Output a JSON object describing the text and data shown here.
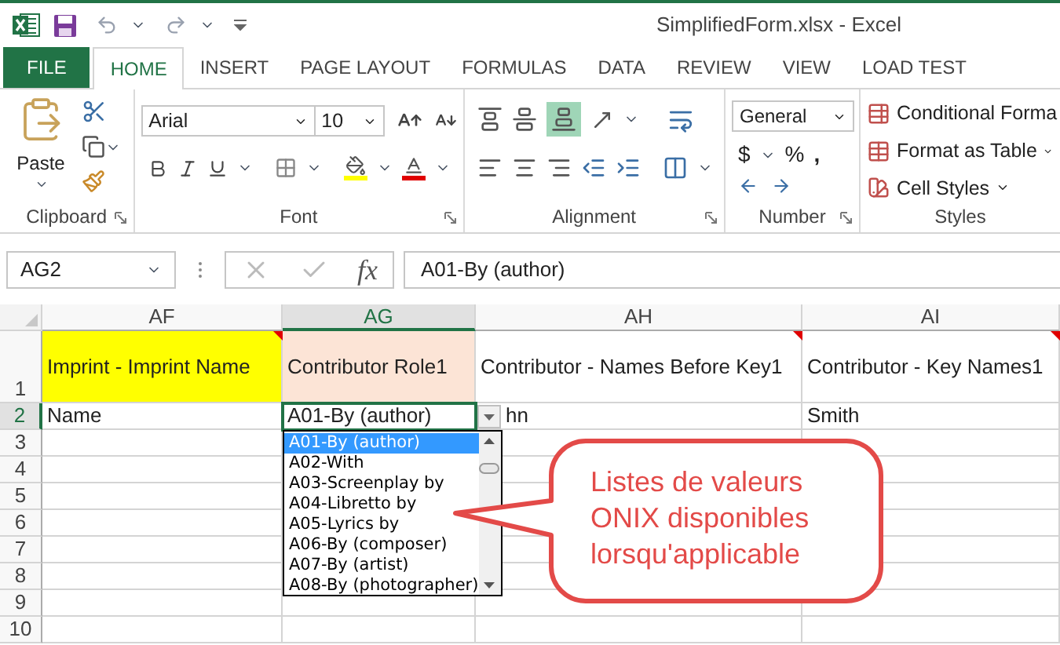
{
  "window": {
    "title": "SimplifiedForm.xlsx - Excel"
  },
  "tabs": [
    {
      "label": "FILE",
      "kind": "file",
      "selected": false
    },
    {
      "label": "HOME",
      "kind": "tab",
      "selected": true
    },
    {
      "label": "INSERT",
      "kind": "tab",
      "selected": false
    },
    {
      "label": "PAGE LAYOUT",
      "kind": "tab",
      "selected": false
    },
    {
      "label": "FORMULAS",
      "kind": "tab",
      "selected": false
    },
    {
      "label": "DATA",
      "kind": "tab",
      "selected": false
    },
    {
      "label": "REVIEW",
      "kind": "tab",
      "selected": false
    },
    {
      "label": "VIEW",
      "kind": "tab",
      "selected": false
    },
    {
      "label": "LOAD TEST",
      "kind": "tab",
      "selected": false
    }
  ],
  "ribbon": {
    "clipboard": {
      "paste": "Paste",
      "label": "Clipboard"
    },
    "font": {
      "name": "Arial",
      "size": "10",
      "label": "Font"
    },
    "alignment": {
      "label": "Alignment"
    },
    "number": {
      "format": "General",
      "currency": "$",
      "percent": "%",
      "comma": ",",
      "label": "Number"
    },
    "styles": {
      "items": [
        "Conditional Forma",
        "Format as Table",
        "Cell Styles"
      ],
      "label": "Styles"
    }
  },
  "formula_bar": {
    "name_box": "AG2",
    "function_button": "fx",
    "formula": "A01-By (author)"
  },
  "columns": [
    {
      "label": "AF",
      "selected": false
    },
    {
      "label": "AG",
      "selected": true
    },
    {
      "label": "AH",
      "selected": false
    },
    {
      "label": "AI",
      "selected": false
    }
  ],
  "rows": [
    {
      "number": "1",
      "selected": false,
      "cells": [
        {
          "text": "Imprint - Imprint Name",
          "color": "#ffff00",
          "comment": true
        },
        {
          "text": "Contributor Role1",
          "color": "#fce4d6",
          "comment": false
        },
        {
          "text": "Contributor - Names Before Key1",
          "comment": true
        },
        {
          "text": "Contributor - Key Names1",
          "comment": true
        }
      ]
    },
    {
      "number": "2",
      "selected": true,
      "cells": [
        {
          "text": "Name"
        },
        {
          "text": "A01-By (author)"
        },
        {
          "text": "hn"
        },
        {
          "text": "Smith"
        }
      ]
    },
    {
      "number": "3",
      "selected": false,
      "cells": []
    },
    {
      "number": "4",
      "selected": false,
      "cells": []
    },
    {
      "number": "5",
      "selected": false,
      "cells": []
    },
    {
      "number": "6",
      "selected": false,
      "cells": []
    },
    {
      "number": "7",
      "selected": false,
      "cells": []
    },
    {
      "number": "8",
      "selected": false,
      "cells": []
    },
    {
      "number": "9",
      "selected": false,
      "cells": []
    },
    {
      "number": "10",
      "selected": false,
      "cells": []
    }
  ],
  "dropdown": {
    "options": [
      {
        "label": "A01-By (author)",
        "selected": true
      },
      {
        "label": "A02-With",
        "selected": false
      },
      {
        "label": "A03-Screenplay by",
        "selected": false
      },
      {
        "label": "A04-Libretto by",
        "selected": false
      },
      {
        "label": "A05-Lyrics by",
        "selected": false
      },
      {
        "label": "A06-By (composer)",
        "selected": false
      },
      {
        "label": "A07-By (artist)",
        "selected": false
      },
      {
        "label": "A08-By (photographer)",
        "selected": false
      }
    ]
  },
  "callout": {
    "lines": [
      "Listes de valeurs",
      "ONIX disponibles",
      "lorsqu'applicable"
    ]
  }
}
